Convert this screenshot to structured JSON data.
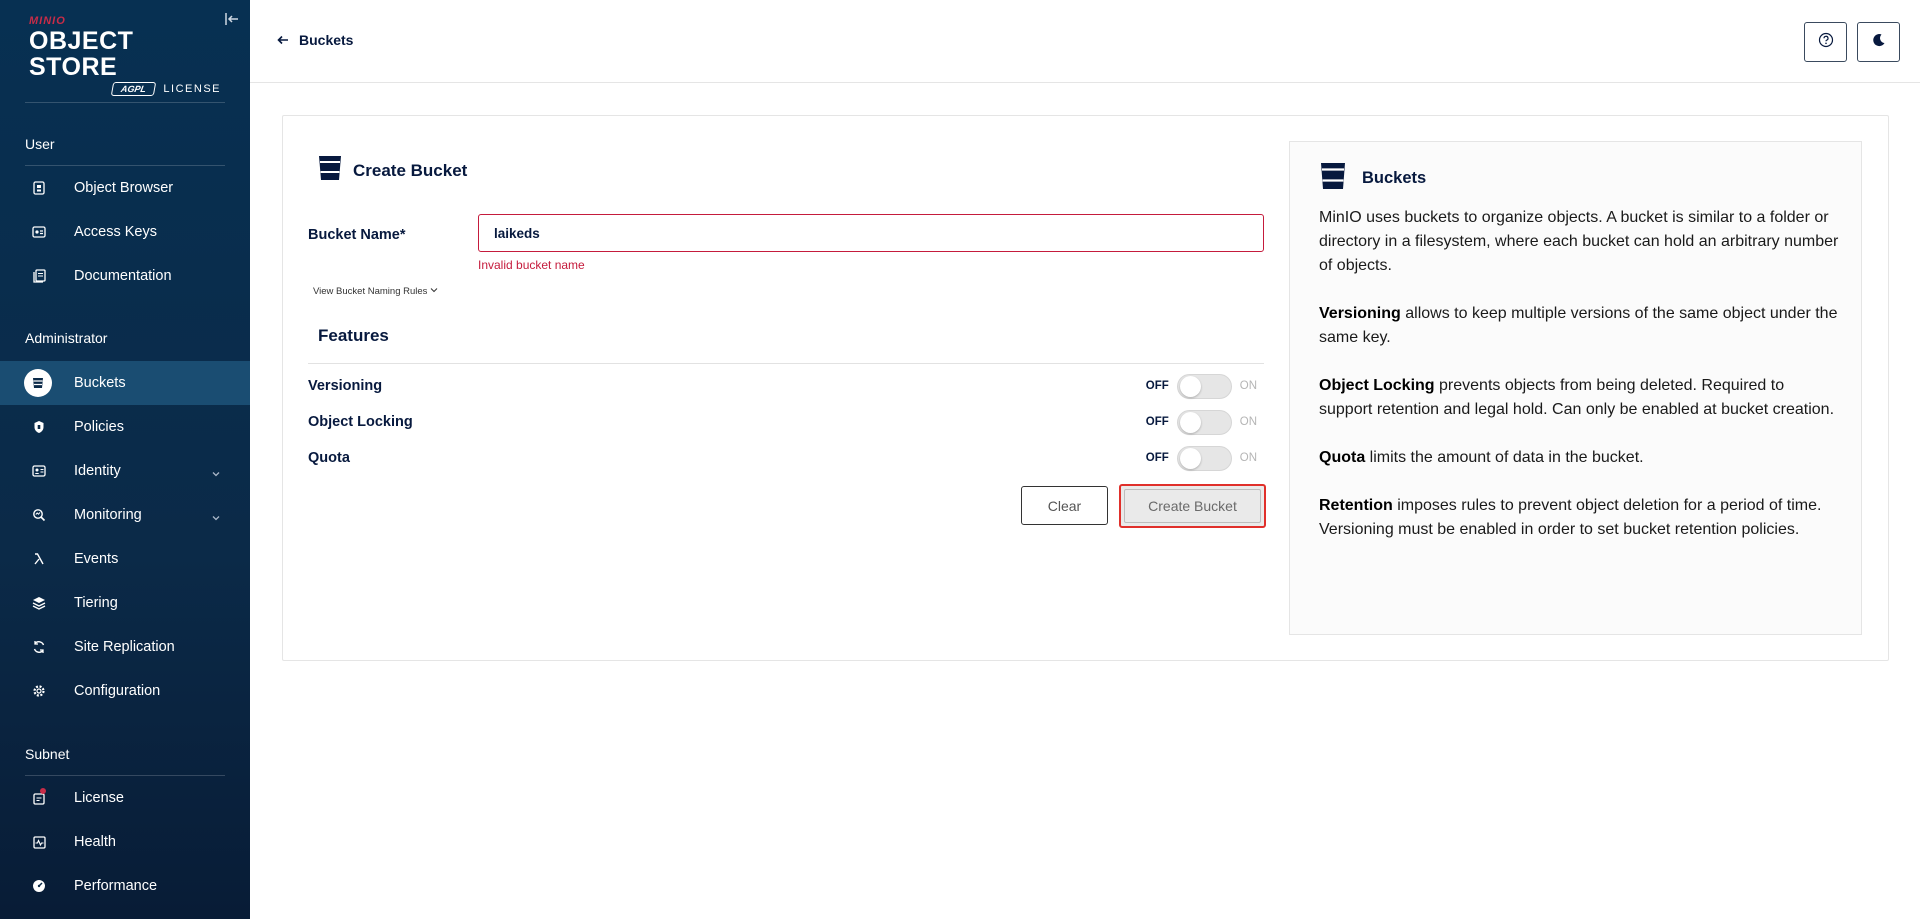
{
  "brand": {
    "small": "MINIO",
    "main": "OBJECT STORE",
    "badge": "AGPL",
    "license_word": "LICENSE"
  },
  "sidebar": {
    "sections": [
      {
        "label": "User",
        "items": [
          {
            "label": "Object Browser",
            "icon": "object-browser-icon"
          },
          {
            "label": "Access Keys",
            "icon": "access-keys-icon"
          },
          {
            "label": "Documentation",
            "icon": "documentation-icon"
          }
        ]
      },
      {
        "label": "Administrator",
        "items": [
          {
            "label": "Buckets",
            "icon": "bucket-icon",
            "active": true
          },
          {
            "label": "Policies",
            "icon": "policies-icon"
          },
          {
            "label": "Identity",
            "icon": "identity-icon",
            "expandable": true
          },
          {
            "label": "Monitoring",
            "icon": "monitoring-icon",
            "expandable": true
          },
          {
            "label": "Events",
            "icon": "lambda-icon"
          },
          {
            "label": "Tiering",
            "icon": "tiering-icon"
          },
          {
            "label": "Site Replication",
            "icon": "site-replication-icon"
          },
          {
            "label": "Configuration",
            "icon": "gear-icon"
          }
        ]
      },
      {
        "label": "Subnet",
        "items": [
          {
            "label": "License",
            "icon": "license-icon",
            "badge": true
          },
          {
            "label": "Health",
            "icon": "health-icon"
          },
          {
            "label": "Performance",
            "icon": "performance-icon"
          }
        ]
      }
    ]
  },
  "header": {
    "back_label": "Buckets"
  },
  "form": {
    "title": "Create Bucket",
    "name_label": "Bucket Name*",
    "name_value": "laikeds",
    "error": "Invalid bucket name",
    "rules_link": "View Bucket Naming Rules",
    "features_title": "Features",
    "features": [
      {
        "label": "Versioning",
        "off": "OFF",
        "on": "ON",
        "enabled": false
      },
      {
        "label": "Object Locking",
        "off": "OFF",
        "on": "ON",
        "enabled": false
      },
      {
        "label": "Quota",
        "off": "OFF",
        "on": "ON",
        "enabled": false
      }
    ],
    "clear_label": "Clear",
    "create_label": "Create Bucket"
  },
  "help": {
    "title": "Buckets",
    "intro": "MinIO uses buckets to organize objects. A bucket is similar to a folder or directory in a filesystem, where each bucket can hold an arbitrary number of objects.",
    "paras": [
      {
        "term": "Versioning",
        "text": " allows to keep multiple versions of the same object under the same key."
      },
      {
        "term": "Object Locking",
        "text": " prevents objects from being deleted. Required to support retention and legal hold. Can only be enabled at bucket creation."
      },
      {
        "term": "Quota",
        "text": " limits the amount of data in the bucket."
      },
      {
        "term": "Retention",
        "text": " imposes rules to prevent object deletion for a period of time. Versioning must be enabled in order to set bucket retention policies."
      }
    ]
  }
}
